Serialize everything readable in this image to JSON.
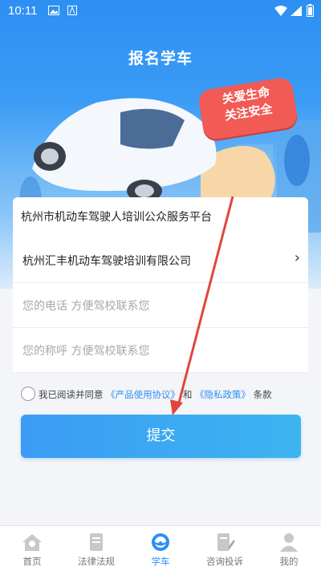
{
  "status_bar": {
    "time": "10:11"
  },
  "header": {
    "title": "报名学车"
  },
  "banner": {
    "slogan_line1": "关爱生命",
    "slogan_line2": "关注安全"
  },
  "platform": {
    "name": "杭州市机动车驾驶人培训公众服务平台"
  },
  "form": {
    "school": {
      "value": "杭州汇丰机动车驾驶培训有限公司"
    },
    "phone": {
      "placeholder": "您的电话 方便驾校联系您"
    },
    "nickname": {
      "placeholder": "您的称呼 方便驾校联系您"
    }
  },
  "agreement": {
    "prefix": "我已阅读并同意",
    "terms": "《产品使用协议》",
    "and": "和",
    "privacy": "《隐私政策》",
    "suffix": "条款"
  },
  "submit_label": "提交",
  "tabbar": [
    {
      "label": "首页",
      "icon": "home-icon"
    },
    {
      "label": "法律法规",
      "icon": "law-book-icon"
    },
    {
      "label": "学车",
      "icon": "steering-wheel-icon"
    },
    {
      "label": "咨询投诉",
      "icon": "complaint-icon"
    },
    {
      "label": "我的",
      "icon": "profile-icon"
    }
  ],
  "colors": {
    "accent": "#2d8ff3",
    "slogan": "#f25a55",
    "arrow": "#e0463e"
  }
}
